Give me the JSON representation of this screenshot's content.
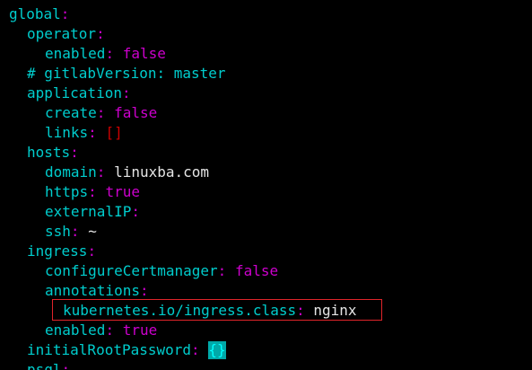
{
  "colors": {
    "background": "#000000",
    "key": "#00cdcd",
    "punctuation": "#cd00cd",
    "boolean": "#cd00cd",
    "brackets": "#cd0000",
    "string": "#e5e5e5",
    "highlight_border": "#e0242a",
    "cursor": "#00a9a9"
  },
  "lines": [
    {
      "key": "global",
      "colon": ":"
    },
    {
      "key": "operator",
      "colon": ":"
    },
    {
      "key": "enabled",
      "colon": ":",
      "value": "false"
    },
    {
      "comment": "# gitlabVersion: master"
    },
    {
      "key": "application",
      "colon": ":"
    },
    {
      "key": "create",
      "colon": ":",
      "value": "false"
    },
    {
      "key": "links",
      "colon": ":",
      "value": "[]"
    },
    {
      "key": "hosts",
      "colon": ":"
    },
    {
      "key": "domain",
      "colon": ":",
      "value": "linuxba.com"
    },
    {
      "key": "https",
      "colon": ":",
      "value": "true"
    },
    {
      "key": "externalIP",
      "colon": ":"
    },
    {
      "key": "ssh",
      "colon": ":",
      "value": "~"
    },
    {
      "key": "ingress",
      "colon": ":"
    },
    {
      "key": "configureCertmanager",
      "colon": ":",
      "value": "false"
    },
    {
      "key": "annotations",
      "colon": ":"
    },
    {
      "key": "kubernetes.io/ingress.class",
      "colon": ":",
      "value": "nginx"
    },
    {
      "key": "enabled",
      "colon": ":",
      "value": "true"
    },
    {
      "key": "initialRootPassword",
      "colon": ":",
      "value": "{}"
    },
    {
      "key": "psql",
      "colon": ":"
    }
  ]
}
